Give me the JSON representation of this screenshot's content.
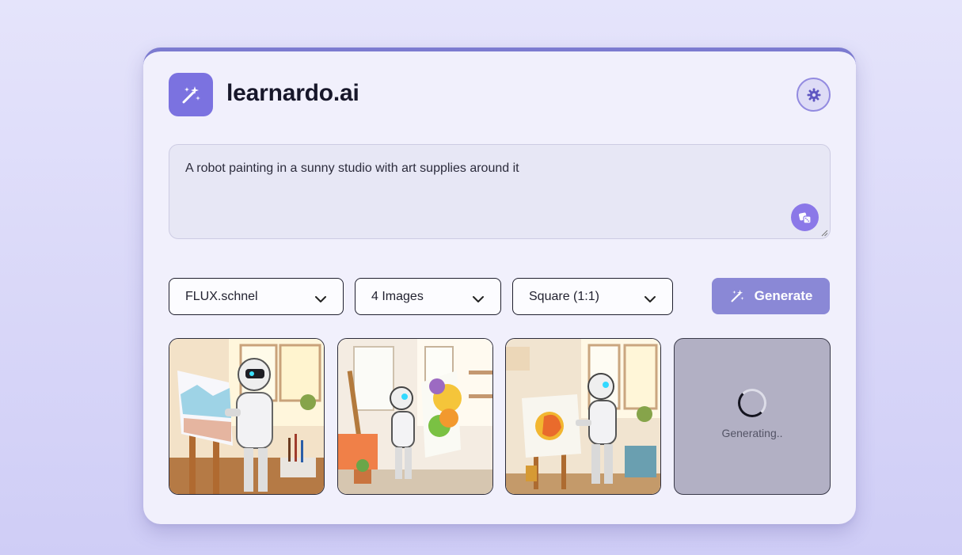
{
  "app": {
    "brand": "learnardo.ai",
    "logo_icon": "magic-wand-icon",
    "theme_icon": "gear-icon",
    "accent": "#7b72e0"
  },
  "prompt": {
    "value": "A robot painting in a sunny studio with art supplies around it",
    "random_icon": "dice-icon"
  },
  "controls": {
    "model": "FLUX.schnel",
    "count": "4 Images",
    "aspect": "Square (1:1)",
    "generate_label": "Generate",
    "generate_icon": "magic-wand-icon"
  },
  "results": {
    "images": [
      {
        "name": "generated-image-1",
        "status": "done"
      },
      {
        "name": "generated-image-2",
        "status": "done"
      },
      {
        "name": "generated-image-3",
        "status": "done"
      }
    ],
    "loading_text": "Generating.."
  }
}
